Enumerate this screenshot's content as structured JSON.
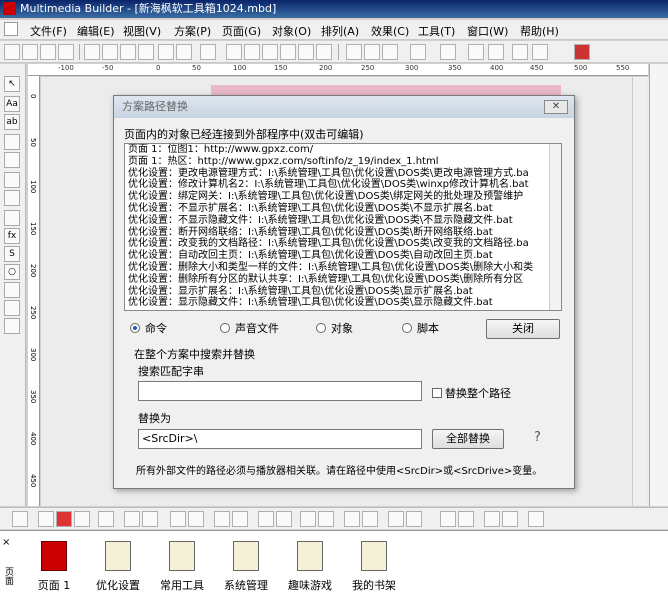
{
  "window": {
    "title": "Multimedia Builder - [新海枫软工具箱1024.mbd]"
  },
  "menu": [
    "文件(F)",
    "编辑(E)",
    "视图(V)",
    "方案(P)",
    "页面(G)",
    "对象(O)",
    "排列(A)",
    "效果(C)",
    "工具(T)",
    "窗口(W)",
    "帮助(H)"
  ],
  "ruler": {
    "h_ticks": [
      "-100",
      "-50",
      "0",
      "50",
      "100",
      "150",
      "200",
      "250",
      "300",
      "350",
      "400",
      "450",
      "500",
      "550"
    ],
    "v_ticks": [
      "0",
      "50",
      "100",
      "150",
      "200",
      "250",
      "300",
      "350",
      "400",
      "450"
    ]
  },
  "dialog": {
    "title": "方案路径替换",
    "close_glyph": "✕",
    "intro": "页面内的对象已经连接到外部程序中(双击可编辑)",
    "list_rows": [
      "页面 1：位图1：http://www.gpxz.com/",
      "页面 1：热区：http://www.gpxz.com/softinfo/z_19/index_1.html",
      "优化设置：更改电源管理方式：I:\\系统管理\\工具包\\优化设置\\DOS类\\更改电源管理方式.ba",
      "优化设置：修改计算机名2：I:\\系统管理\\工具包\\优化设置\\DOS类\\winxp修改计算机名.bat",
      "优化设置：绑定网关：I:\\系统管理\\工具包\\优化设置\\DOS类\\绑定网关的批处理及预警维护",
      "优化设置：不显示扩展名：I:\\系统管理\\工具包\\优化设置\\DOS类\\不显示扩展名.bat",
      "优化设置：不显示隐藏文件：I:\\系统管理\\工具包\\优化设置\\DOS类\\不显示隐藏文件.bat",
      "优化设置：断开网络联络：I:\\系统管理\\工具包\\优化设置\\DOS类\\断开网络联络.bat",
      "优化设置：改变我的文档路径：I:\\系统管理\\工具包\\优化设置\\DOS类\\改变我的文档路径.ba",
      "优化设置：自动改回主页：I:\\系统管理\\工具包\\优化设置\\DOS类\\自动改回主页.bat",
      "优化设置：删除大小和类型一样的文件：I:\\系统管理\\工具包\\优化设置\\DOS类\\删除大小和类",
      "优化设置：删除所有分区的默认共享：I:\\系统管理\\工具包\\优化设置\\DOS类\\删除所有分区",
      "优化设置：显示扩展名：I:\\系统管理\\工具包\\优化设置\\DOS类\\显示扩展名.bat",
      "优化设置：显示隐藏文件：I:\\系统管理\\工具包\\优化设置\\DOS类\\显示隐藏文件.bat"
    ],
    "radios": {
      "command": "命令",
      "sound": "声音文件",
      "object": "对象",
      "script": "脚本"
    },
    "close_button": "关闭",
    "search_heading": "在整个方案中搜索并替换",
    "search_label": "搜索匹配字串",
    "search_value": "",
    "replace_whole_path": "替换整个路径",
    "replace_label": "替换为",
    "replace_value": "<SrcDir>\\",
    "replace_all_button": "全部替换",
    "help_glyph": "?",
    "note": "所有外部文件的路径必须与播放器相关联。请在路径中使用<SrcDir>或<SrcDrive>变量。"
  },
  "pages": [
    "页面 1",
    "优化设置",
    "常用工具",
    "系统管理",
    "趣味游戏",
    "我的书架"
  ],
  "side_tab": "页面"
}
